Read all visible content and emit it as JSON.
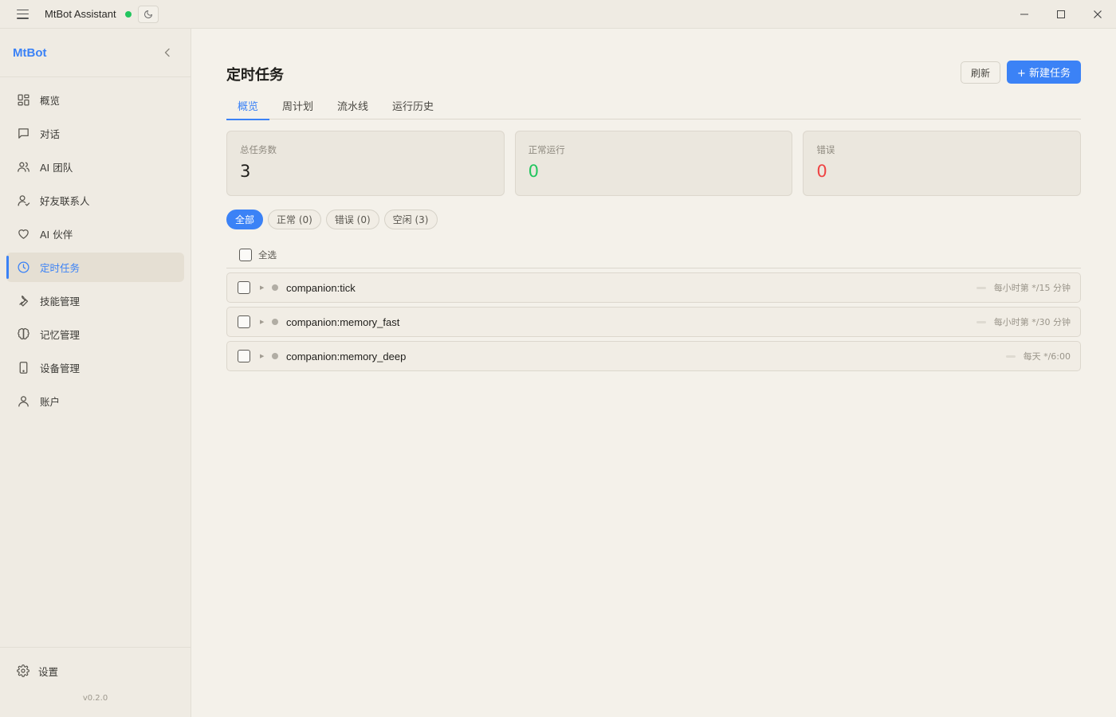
{
  "app": {
    "title": "MtBot Assistant",
    "status_color": "#22c55e",
    "accent": "#3b82f6"
  },
  "sidebar": {
    "brand": "MtBot",
    "items": [
      {
        "label": "概览",
        "icon": "dashboard-icon"
      },
      {
        "label": "对话",
        "icon": "chat-bubble-icon"
      },
      {
        "label": "AI 团队",
        "icon": "users-icon"
      },
      {
        "label": "好友联系人",
        "icon": "contact-icon"
      },
      {
        "label": "AI 伙伴",
        "icon": "heart-icon"
      },
      {
        "label": "定时任务",
        "icon": "clock-icon",
        "active": true
      },
      {
        "label": "技能管理",
        "icon": "wrench-icon"
      },
      {
        "label": "记忆管理",
        "icon": "brain-icon"
      },
      {
        "label": "设备管理",
        "icon": "phone-icon"
      },
      {
        "label": "账户",
        "icon": "user-icon"
      }
    ],
    "settings_label": "设置",
    "version": "v0.2.0"
  },
  "page": {
    "title": "定时任务",
    "refresh_label": "刷新",
    "new_task_label": "+ 新建任务",
    "tabs": [
      "概览",
      "周计划",
      "流水线",
      "运行历史"
    ],
    "active_tab": "概览"
  },
  "stats": [
    {
      "label": "总任务数",
      "value": "3",
      "color": "#1f1e1b"
    },
    {
      "label": "正常运行",
      "value": "0",
      "color": "#22c55e"
    },
    {
      "label": "错误",
      "value": "0",
      "color": "#ef4444"
    }
  ],
  "filters": [
    "全部",
    "正常 (0)",
    "错误 (0)",
    "空闲 (3)"
  ],
  "active_filter": "全部",
  "select_all_label": "全选",
  "tasks": [
    {
      "name": "companion:tick",
      "schedule": "每小时第 */15 分钟"
    },
    {
      "name": "companion:memory_fast",
      "schedule": "每小时第 */30 分钟"
    },
    {
      "name": "companion:memory_deep",
      "schedule": "每天 */6:00"
    }
  ]
}
